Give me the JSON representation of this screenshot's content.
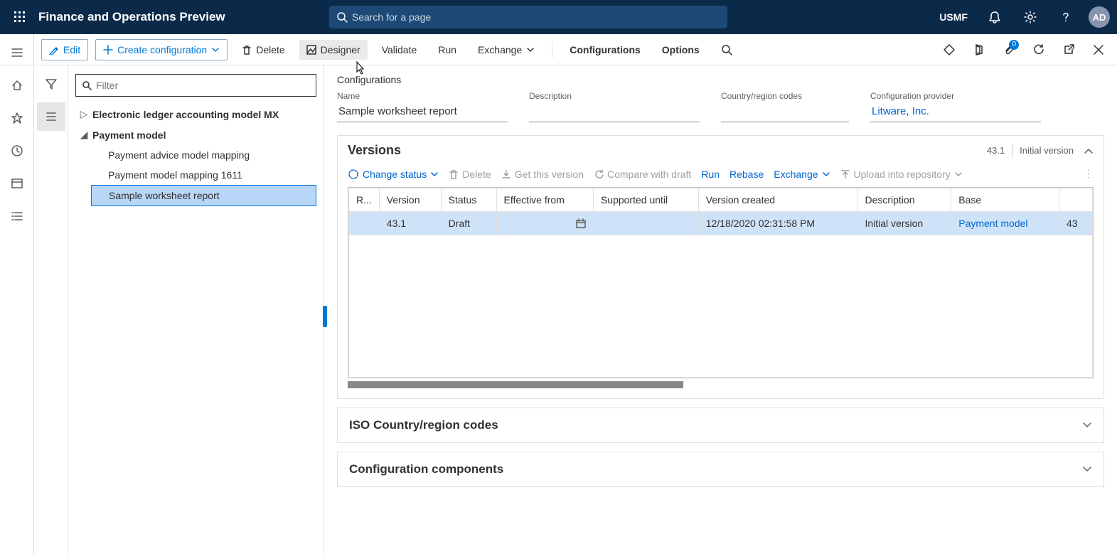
{
  "topnav": {
    "app_title": "Finance and Operations Preview",
    "search_placeholder": "Search for a page",
    "company": "USMF",
    "avatar": "AD"
  },
  "cmdbar": {
    "edit": "Edit",
    "create": "Create configuration",
    "delete": "Delete",
    "designer": "Designer",
    "validate": "Validate",
    "run": "Run",
    "exchange": "Exchange",
    "configurations": "Configurations",
    "options": "Options",
    "attach_badge": "0"
  },
  "tree": {
    "filter_placeholder": "Filter",
    "items": [
      {
        "label": "Electronic ledger accounting model MX",
        "bold": true,
        "caret": "▷"
      },
      {
        "label": "Payment model",
        "bold": true,
        "caret": "◢",
        "children": [
          {
            "label": "Payment advice model mapping"
          },
          {
            "label": "Payment model mapping 1611"
          },
          {
            "label": "Sample worksheet report",
            "selected": true
          }
        ]
      }
    ]
  },
  "main": {
    "breadcrumb": "Configurations",
    "fields": {
      "name_label": "Name",
      "name_value": "Sample worksheet report",
      "desc_label": "Description",
      "desc_value": "",
      "country_label": "Country/region codes",
      "country_value": "",
      "provider_label": "Configuration provider",
      "provider_value": "Litware, Inc."
    },
    "versions": {
      "title": "Versions",
      "summary_version": "43.1",
      "summary_desc": "Initial version",
      "toolbar": {
        "change_status": "Change status",
        "delete": "Delete",
        "get_version": "Get this version",
        "compare": "Compare with draft",
        "run": "Run",
        "rebase": "Rebase",
        "exchange": "Exchange",
        "upload": "Upload into repository"
      },
      "columns": [
        "R...",
        "Version",
        "Status",
        "Effective from",
        "Supported until",
        "Version created",
        "Description",
        "Base",
        ""
      ],
      "rows": [
        {
          "r": "",
          "version": "43.1",
          "status": "Draft",
          "effective": "",
          "supported": "",
          "created": "12/18/2020 02:31:58 PM",
          "description": "Initial version",
          "base": "Payment model",
          "base_ver": "43"
        }
      ]
    },
    "iso_section": "ISO Country/region codes",
    "components_section": "Configuration components"
  }
}
